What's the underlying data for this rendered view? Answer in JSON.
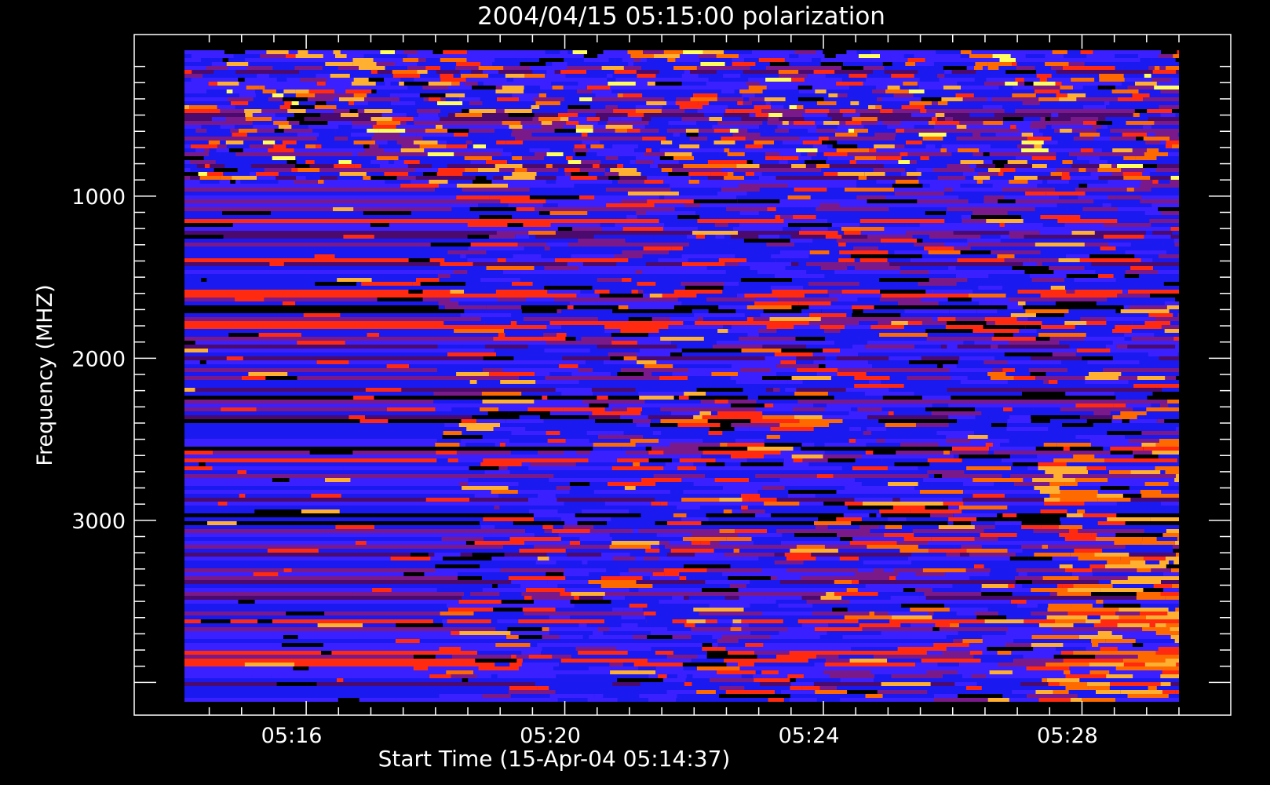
{
  "chart_data": {
    "type": "heatmap",
    "title": "2004/04/15 05:15:00 polarization",
    "xlabel": "Start Time (15-Apr-04 05:14:37)",
    "ylabel": "Frequency (MHZ)",
    "x_range": [
      "05:14:37",
      "30:00"
    ],
    "x_ticks": [
      {
        "t": 76.5,
        "label": "05:16"
      },
      {
        "t": 316.5,
        "label": "05:20"
      },
      {
        "t": 556.5,
        "label": "05:24"
      },
      {
        "t": 796.5,
        "label": "05:28"
      }
    ],
    "x_ticks_t_unit": "seconds after 05:15:00",
    "y_range": [
      100,
      4100
    ],
    "y_reversed": true,
    "y_ticks": [
      {
        "value": 1000,
        "label": "1000"
      },
      {
        "value": 2000,
        "label": "2000"
      },
      {
        "value": 3000,
        "label": "3000"
      }
    ],
    "grid": false,
    "colorscale": [
      "#000000",
      "#4a0a6e",
      "#7a1a8a",
      "#1a1af0",
      "#3a20ff",
      "#ff2a10",
      "#ff6a00",
      "#ffb030",
      "#ffff60",
      "#ffffff"
    ],
    "notes": "Dense spectrogram; cell values approximated by a banded pattern"
  },
  "colors": {
    "background": "#000000",
    "axis": "#ffffff",
    "text": "#ffffff"
  }
}
